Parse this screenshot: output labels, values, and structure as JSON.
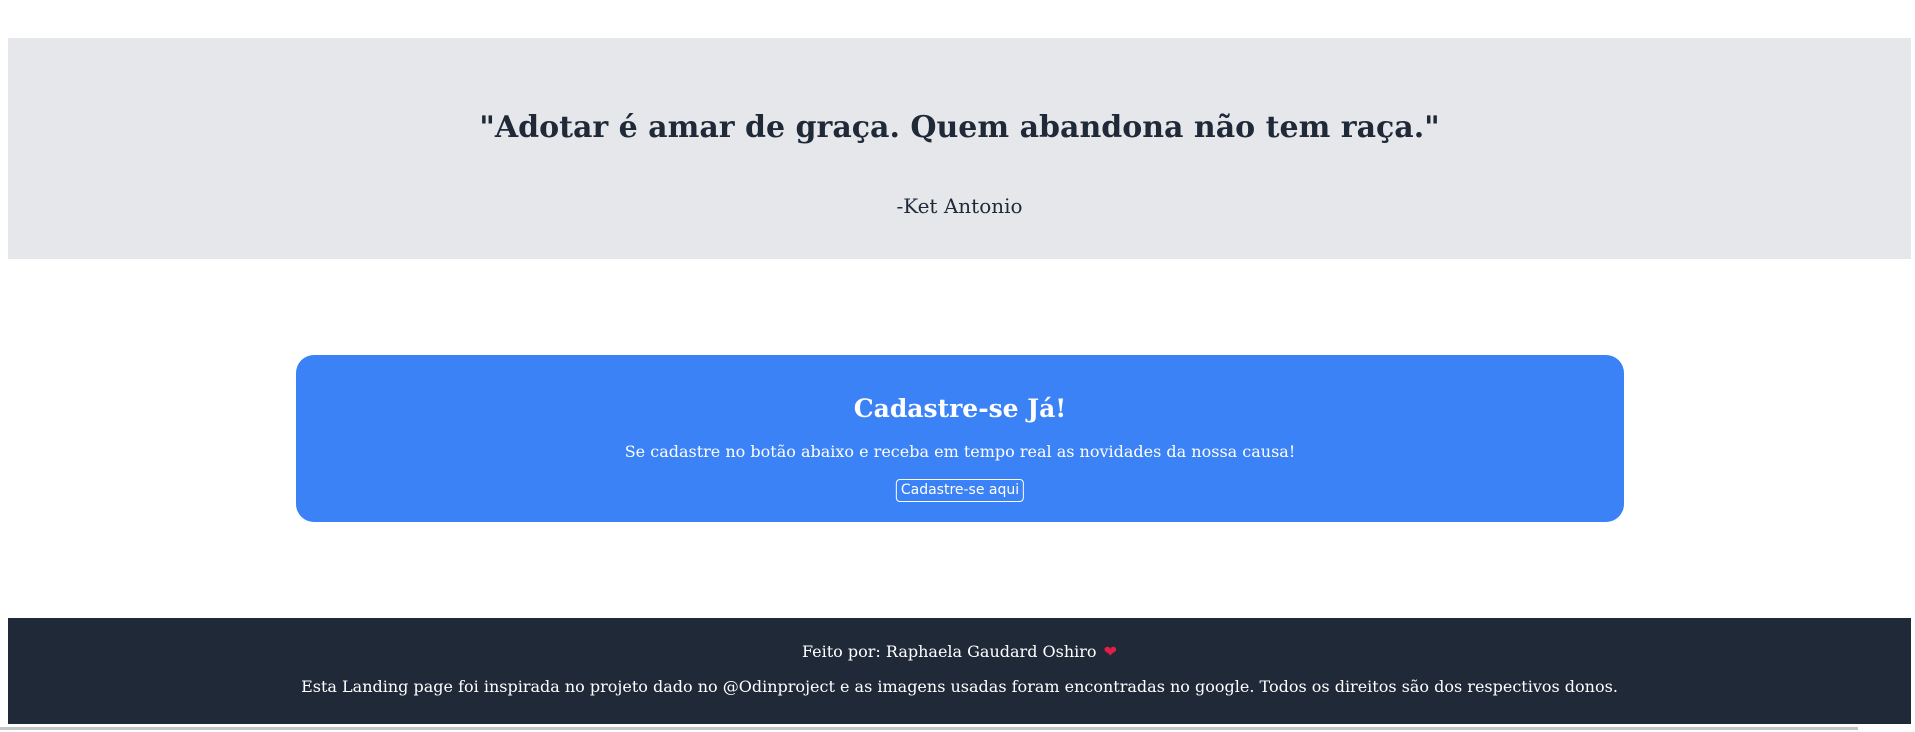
{
  "quote": {
    "text": "\"Adotar é amar de graça. Quem abandona não tem raça.\"",
    "author": "-Ket Antonio"
  },
  "cta": {
    "title": "Cadastre-se Já!",
    "text": "Se cadastre no botão abaixo e receba em tempo real as novidades da nossa causa!",
    "button_label": "Cadastre-se aqui"
  },
  "footer": {
    "credit": "Feito por: Raphaela Gaudard Oshiro",
    "heart_icon": "heart-icon",
    "note": "Esta Landing page foi inspirada no projeto dado no @Odinproject e as imagens usadas foram encontradas no google. Todos os direitos são dos respectivos donos."
  },
  "colors": {
    "quote_bg": "#e5e7eb",
    "text_dark": "#1f2937",
    "cta_bg": "#3b82f6",
    "footer_bg": "#1f2937",
    "heart": "#e11d48"
  }
}
